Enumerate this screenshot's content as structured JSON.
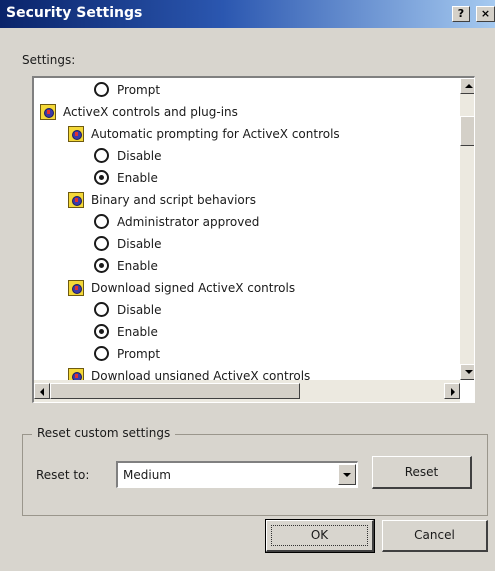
{
  "window": {
    "title": "Security Settings",
    "help_label": "?",
    "close_label": "×"
  },
  "settings_label": "Settings:",
  "settings_list": [
    {
      "kind": "radio",
      "label": "Prompt",
      "checked": false
    },
    {
      "kind": "category",
      "label": "ActiveX controls and plug-ins",
      "icon": "security-setting-icon"
    },
    {
      "kind": "setting",
      "label": "Automatic prompting for ActiveX controls",
      "icon": "security-setting-icon"
    },
    {
      "kind": "radio",
      "label": "Disable",
      "checked": false
    },
    {
      "kind": "radio",
      "label": "Enable",
      "checked": true
    },
    {
      "kind": "setting",
      "label": "Binary and script behaviors",
      "icon": "security-setting-icon"
    },
    {
      "kind": "radio",
      "label": "Administrator approved",
      "checked": false
    },
    {
      "kind": "radio",
      "label": "Disable",
      "checked": false
    },
    {
      "kind": "radio",
      "label": "Enable",
      "checked": true
    },
    {
      "kind": "setting",
      "label": "Download signed ActiveX controls",
      "icon": "security-setting-icon"
    },
    {
      "kind": "radio",
      "label": "Disable",
      "checked": false
    },
    {
      "kind": "radio",
      "label": "Enable",
      "checked": true
    },
    {
      "kind": "radio",
      "label": "Prompt",
      "checked": false
    },
    {
      "kind": "setting",
      "label": "Download unsigned ActiveX controls",
      "icon": "security-setting-icon"
    }
  ],
  "reset_group": {
    "title": "Reset custom settings",
    "reset_to_label": "Reset to:",
    "selected": "Medium",
    "reset_button": "Reset"
  },
  "buttons": {
    "ok": "OK",
    "cancel": "Cancel"
  },
  "colors": {
    "title_bar": "#0a246a",
    "dialog_face": "#d8d5ce"
  }
}
